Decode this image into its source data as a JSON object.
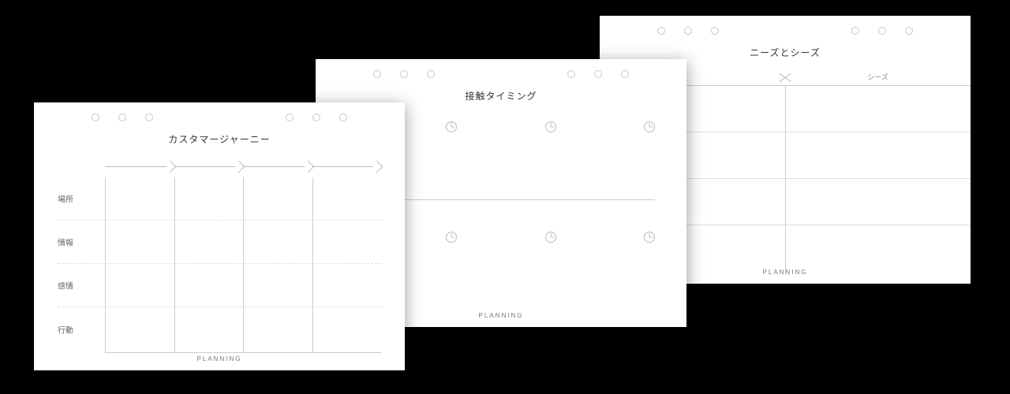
{
  "sheets": {
    "journey": {
      "title": "カスタマージャーニー",
      "rows": [
        "場所",
        "情報",
        "感情",
        "行動"
      ],
      "footer": "PLANNING"
    },
    "timing": {
      "title": "接触タイミング",
      "footer": "PLANNING"
    },
    "needs": {
      "title": "ニーズとシーズ",
      "col_right": "シーズ",
      "footer": "PLANNING"
    }
  }
}
